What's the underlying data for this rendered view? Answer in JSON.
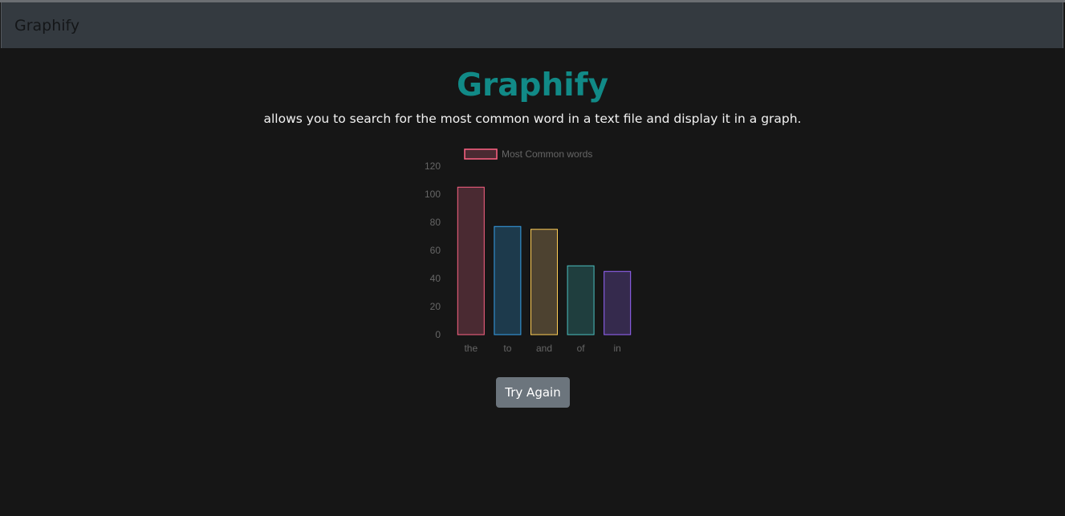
{
  "navbar": {
    "brand": "Graphify"
  },
  "header": {
    "title": "Graphify",
    "subtitle": "allows you to search for the most common word in a text file and display it in a graph."
  },
  "actions": {
    "try_again_label": "Try Again"
  },
  "colors": {
    "title": "#118a87",
    "button": "#6c757d",
    "axis_text": "#666666"
  },
  "chart_data": {
    "type": "bar",
    "categories": [
      "the",
      "to",
      "and",
      "of",
      "in"
    ],
    "series": [
      {
        "name": "Most Common words",
        "values": [
          105,
          77,
          75,
          49,
          45
        ]
      }
    ],
    "ylim": [
      0,
      120
    ],
    "yticks": [
      0,
      20,
      40,
      60,
      80,
      100,
      120
    ],
    "legend": "top",
    "grid": false,
    "bar_fill_colors": [
      "#4a2a32",
      "#1d3a4c",
      "#4d4230",
      "#1f3e3e",
      "#352a4d"
    ],
    "bar_border_colors": [
      "#ff6384",
      "#36a2eb",
      "#ffce56",
      "#4bc0c0",
      "#9966ff"
    ]
  }
}
